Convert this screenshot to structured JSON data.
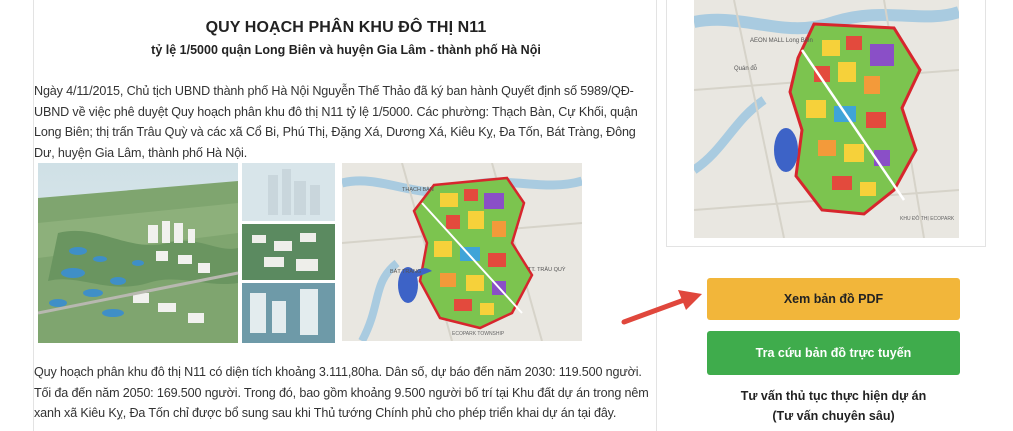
{
  "article": {
    "title": "QUY HOẠCH PHÂN KHU ĐÔ THỊ  N11",
    "subtitle": "tỷ lệ 1/5000 quận Long Biên và huyện Gia Lâm - thành phố Hà Nội",
    "paragraph1": "Ngày 4/11/2015, Chủ tịch UBND thành phố Hà Nội Nguyễn Thế Thảo đã ký ban hành Quyết định số 5989/QĐ-UBND về việc phê duyệt Quy hoạch phân khu đô thị N11 tỷ lệ 1/5000. Các phường: Thạch Bàn, Cự Khối, quận Long Biên; thị trấn Trâu Quỳ và các xã Cổ Bi, Phú Thị, Đặng Xá, Dương Xá, Kiêu Kỵ, Đa Tốn, Bát Tràng, Đông Dư, huyện Gia Lâm, thành phố Hà Nội.",
    "paragraph2": "Quy hoạch phân khu đô thị N11 có diện tích khoảng 3.111,80ha. Dân số, dự báo đến năm 2030: 119.500 người. Tối đa đến năm 2050: 169.500 người. Trong đó, bao gồm khoảng 9.500 người bố trí tại Khu đất dự án trong nêm xanh xã Kiêu Kỵ, Đa Tốn chỉ được bổ sung sau khi Thủ tướng Chính phủ cho phép triển khai dự án tại đây.",
    "map_labels": {
      "thach_ban": "THẠCH BÀN",
      "trau_quy": "TT. TRÂU QUỲ",
      "bat_trang": "BÁT TRÀNG",
      "ecopark": "ECOPARK TOWNSHIP"
    }
  },
  "sidebar": {
    "map_labels": {
      "aeon": "AEON MALL Long Biên",
      "quan_do": "Quán đỗ",
      "khu_do_thi": "KHU ĐÔ THỊ ECOPARK"
    },
    "pdf_button": "Xem bản đồ PDF",
    "online_button": "Tra cứu bản đồ trực tuyến",
    "advice_line1": "Tư vấn thủ tục thực hiện dự án",
    "advice_line2": "(Tư vấn chuyên sâu)"
  },
  "colors": {
    "pdf_button": "#f2b63a",
    "online_button": "#3fac4c",
    "arrow": "#e0473c",
    "boundary": "#d7262d"
  }
}
